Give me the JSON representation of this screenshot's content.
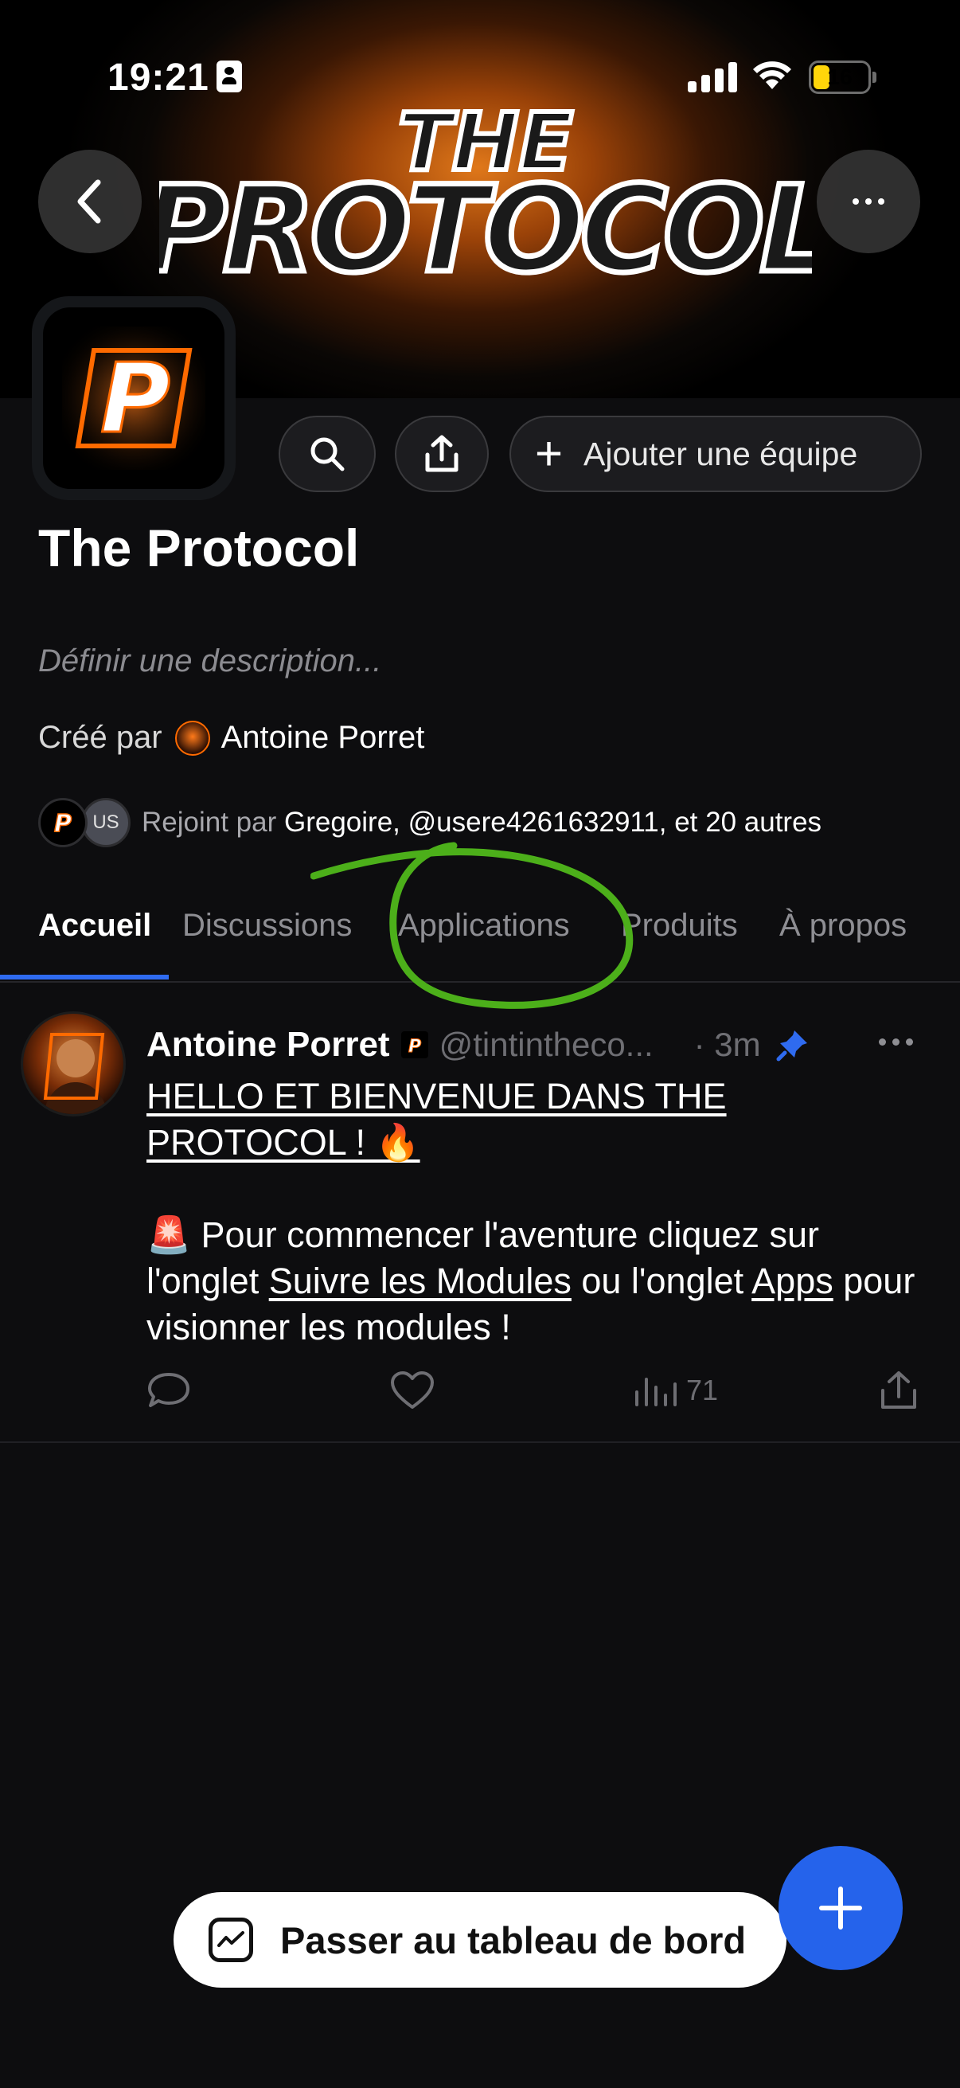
{
  "status_bar": {
    "time": "19:21",
    "battery": "16"
  },
  "banner": {
    "logo_line1": "THE",
    "logo_line2": "PROTOCOL"
  },
  "header": {
    "add_team_label": "Ajouter une équipe"
  },
  "community": {
    "title": "The Protocol",
    "description_placeholder": "Définir une description...",
    "created_prefix": "Créé par",
    "creator_name": "Antoine Porret",
    "joined_prefix": "Rejoint par",
    "joined_names": "Gregoire, @usere4261632911, et 20 autres",
    "joined_avatar_initials": "US",
    "logo_letter": "P"
  },
  "tabs": [
    {
      "label": "Accueil",
      "active": true
    },
    {
      "label": "Discussions"
    },
    {
      "label": "Applications"
    },
    {
      "label": "Produits"
    },
    {
      "label": "À propos"
    }
  ],
  "post": {
    "author": "Antoine Porret",
    "handle": "@tintintheco...",
    "time": "· 3m",
    "headline_line1": "HELLO ET BIENVENUE DANS THE",
    "headline_line2": "PROTOCOL ! 🔥",
    "body_emoji": "🚨",
    "body_part1": " Pour commencer l'aventure cliquez sur l'onglet ",
    "body_link1": "Suivre les Modules",
    "body_part2": " ou l'onglet ",
    "body_link2": "Apps",
    "body_part3": " pour visionner les modules !",
    "views": "71"
  },
  "bottom": {
    "dashboard_label": "Passer au tableau de bord"
  },
  "colors": {
    "accent_blue": "#2563eb",
    "annotation_green": "#4caf1a",
    "banner_orange": "#e0781a"
  }
}
